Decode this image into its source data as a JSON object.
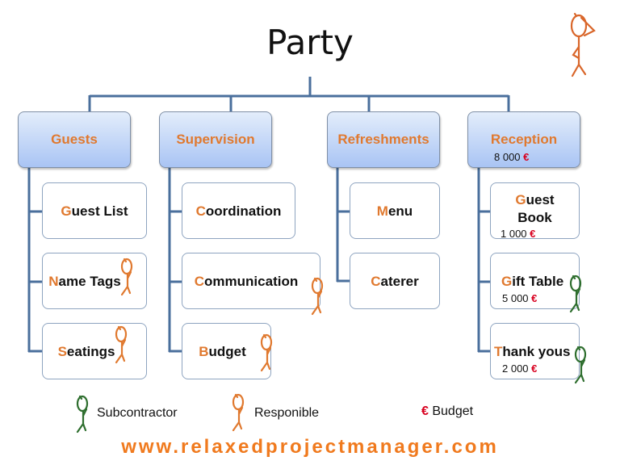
{
  "title": "Party",
  "colors": {
    "accent_orange": "#e0792f",
    "subcontractor_green": "#2e6e2e",
    "responsible_orange": "#e0792f",
    "euro_red": "#d8001f",
    "connector_blue": "#4a6f9c"
  },
  "branches": [
    {
      "label": "Guests",
      "budget": null,
      "children": [
        {
          "first": "G",
          "rest": "uest List",
          "budget": null,
          "role": null
        },
        {
          "first": "N",
          "rest": "ame Tags",
          "budget": null,
          "role": "responsible"
        },
        {
          "first": "S",
          "rest": "eatings",
          "budget": null,
          "role": "responsible"
        }
      ]
    },
    {
      "label": "Supervision",
      "budget": null,
      "children": [
        {
          "first": "C",
          "rest": "oordination",
          "budget": null,
          "role": null
        },
        {
          "first": "C",
          "rest": "ommunication",
          "budget": null,
          "role": "responsible"
        },
        {
          "first": "B",
          "rest": "udget",
          "budget": null,
          "role": "responsible"
        }
      ]
    },
    {
      "label": "Refreshments",
      "budget": null,
      "children": [
        {
          "first": "M",
          "rest": "enu",
          "budget": null,
          "role": null
        },
        {
          "first": "C",
          "rest": "aterer",
          "budget": null,
          "role": null
        }
      ]
    },
    {
      "label": "Reception",
      "budget": {
        "amount": "8 000",
        "currency": "€"
      },
      "children": [
        {
          "first": "G",
          "rest": "uest",
          "line2": "Book",
          "budget": {
            "amount": "1 000",
            "currency": "€"
          },
          "role": null
        },
        {
          "first": "G",
          "rest": "ift Table",
          "budget": {
            "amount": "5 000",
            "currency": "€"
          },
          "role": "subcontractor"
        },
        {
          "first": "T",
          "rest": "hank yous",
          "budget": {
            "amount": "2 000",
            "currency": "€"
          },
          "role": "subcontractor"
        }
      ]
    }
  ],
  "legend": {
    "subcontractor": "Subcontractor",
    "responsible": "Responible",
    "budget_symbol": "€",
    "budget": "Budget"
  },
  "footer": "www.relaxedprojectmanager.com",
  "icons": {
    "manager": "stick-figure-manager-icon",
    "subcontractor": "stick-figure-green-icon",
    "responsible": "stick-figure-orange-icon"
  }
}
